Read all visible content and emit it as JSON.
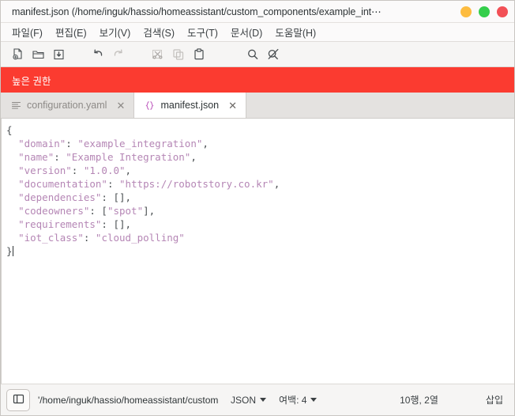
{
  "window": {
    "title": "manifest.json (/home/inguk/hassio/homeassistant/custom_components/example_int⋯",
    "controls": {
      "minimize": "minimize-button",
      "maximize": "maximize-button",
      "close": "close-button"
    },
    "colors": {
      "minimize": "#fdbc40",
      "maximize": "#34ce4b",
      "close": "#f25056",
      "banner": "#fb3b30",
      "string": "#b586b5",
      "tab_icon_json": "#c060c0"
    }
  },
  "menubar": {
    "items": [
      {
        "label": "파일(F)",
        "name": "menu-file"
      },
      {
        "label": "편집(E)",
        "name": "menu-edit"
      },
      {
        "label": "보기(V)",
        "name": "menu-view"
      },
      {
        "label": "검색(S)",
        "name": "menu-search"
      },
      {
        "label": "도구(T)",
        "name": "menu-tools"
      },
      {
        "label": "문서(D)",
        "name": "menu-documents"
      },
      {
        "label": "도움말(H)",
        "name": "menu-help"
      }
    ]
  },
  "toolbar": {
    "buttons": [
      {
        "name": "new-file-icon",
        "enabled": true
      },
      {
        "name": "open-folder-icon",
        "enabled": true
      },
      {
        "name": "save-icon",
        "enabled": true
      },
      {
        "name": "undo-icon",
        "enabled": true
      },
      {
        "name": "redo-icon",
        "enabled": false
      },
      {
        "name": "cut-icon",
        "enabled": false
      },
      {
        "name": "copy-icon",
        "enabled": false
      },
      {
        "name": "paste-icon",
        "enabled": true
      },
      {
        "name": "search-icon",
        "enabled": true
      },
      {
        "name": "replace-icon",
        "enabled": true
      }
    ]
  },
  "banner": {
    "text": "높은 권한"
  },
  "tabs": [
    {
      "label": "configuration.yaml",
      "icon": "yaml-lines-icon",
      "close": "✕",
      "active": false
    },
    {
      "label": "manifest.json",
      "icon": "json-braces-icon",
      "close": "✕",
      "active": true
    }
  ],
  "editor": {
    "lines": [
      {
        "indent": 0,
        "segments": [
          {
            "t": "{",
            "c": "pun"
          }
        ]
      },
      {
        "indent": 1,
        "segments": [
          {
            "t": "\"domain\"",
            "c": "str"
          },
          {
            "t": ": ",
            "c": "pun"
          },
          {
            "t": "\"example_integration\"",
            "c": "str"
          },
          {
            "t": ",",
            "c": "pun"
          }
        ]
      },
      {
        "indent": 1,
        "segments": [
          {
            "t": "\"name\"",
            "c": "str"
          },
          {
            "t": ": ",
            "c": "pun"
          },
          {
            "t": "\"Example Integration\"",
            "c": "str"
          },
          {
            "t": ",",
            "c": "pun"
          }
        ]
      },
      {
        "indent": 1,
        "segments": [
          {
            "t": "\"version\"",
            "c": "str"
          },
          {
            "t": ": ",
            "c": "pun"
          },
          {
            "t": "\"1.0.0\"",
            "c": "str"
          },
          {
            "t": ",",
            "c": "pun"
          }
        ]
      },
      {
        "indent": 1,
        "segments": [
          {
            "t": "\"documentation\"",
            "c": "str"
          },
          {
            "t": ": ",
            "c": "pun"
          },
          {
            "t": "\"https://robotstory.co.kr\"",
            "c": "str"
          },
          {
            "t": ",",
            "c": "pun"
          }
        ]
      },
      {
        "indent": 1,
        "segments": [
          {
            "t": "\"dependencies\"",
            "c": "str"
          },
          {
            "t": ": [],",
            "c": "pun"
          }
        ]
      },
      {
        "indent": 1,
        "segments": [
          {
            "t": "\"codeowners\"",
            "c": "str"
          },
          {
            "t": ": [",
            "c": "pun"
          },
          {
            "t": "\"spot\"",
            "c": "str"
          },
          {
            "t": "],",
            "c": "pun"
          }
        ]
      },
      {
        "indent": 1,
        "segments": [
          {
            "t": "\"requirements\"",
            "c": "str"
          },
          {
            "t": ": [],",
            "c": "pun"
          }
        ]
      },
      {
        "indent": 1,
        "segments": [
          {
            "t": "\"iot_class\"",
            "c": "str"
          },
          {
            "t": ": ",
            "c": "pun"
          },
          {
            "t": "\"cloud_polling\"",
            "c": "str"
          }
        ]
      },
      {
        "indent": 0,
        "segments": [
          {
            "t": "}",
            "c": "pun"
          }
        ],
        "caret": true
      }
    ]
  },
  "statusbar": {
    "sidebar_toggle": "sidebar-toggle-icon",
    "path": "'/home/inguk/hassio/homeassistant/custom⋯",
    "syntax": "JSON",
    "indent": "여백: 4",
    "position": "10행, 2열",
    "mode": "삽입"
  }
}
